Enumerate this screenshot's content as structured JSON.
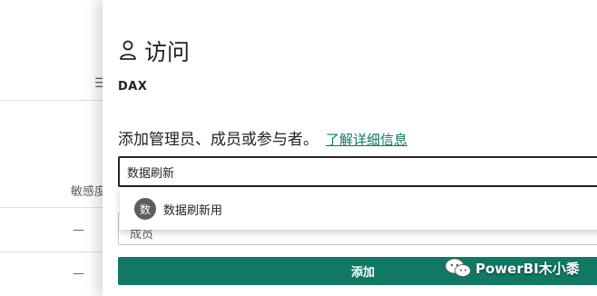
{
  "background": {
    "menu_icon": "☰",
    "column_header": "敏感度",
    "dash_1": "—",
    "dash_2": "—"
  },
  "panel": {
    "title": "访问",
    "dataset_name": "DAX",
    "instruction": "添加管理员、成员或参与者。",
    "learn_more": "了解详细信息",
    "search_value": "数据刷新",
    "permission_label": "成员",
    "suggestion": {
      "avatar_initial": "数",
      "name": "数据刷新用"
    },
    "add_button": "添加"
  },
  "watermark": {
    "text": "PowerBI木小黍"
  },
  "colors": {
    "accent": "#117865",
    "text": "#252423",
    "avatar_bg": "#605e5c"
  }
}
